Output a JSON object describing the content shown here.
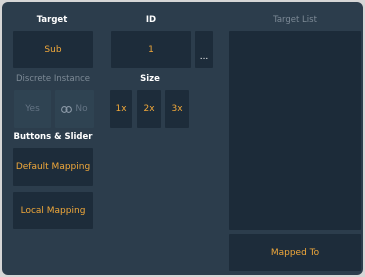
{
  "labels": {
    "target": "Target",
    "id": "ID",
    "target_list": "Target List",
    "discrete_instance": "Discrete Instance",
    "size": "Size",
    "buttons_slider": "Buttons & Slider"
  },
  "buttons": {
    "target_value": "Sub",
    "id_value": "1",
    "id_more": "...",
    "discrete_yes": "Yes",
    "discrete_no": "No",
    "size_1x": "1x",
    "size_2x": "2x",
    "size_3x": "3x",
    "default_mapping": "Default Mapping",
    "local_mapping": "Local Mapping",
    "mapped_to": "Mapped To"
  },
  "icons": {
    "link": "link-icon"
  },
  "colors": {
    "panel_bg": "#2c3d4c",
    "button_bg": "#1d2c3a",
    "accent_text": "#f0a83a",
    "dim_text": "#7d8a96"
  }
}
